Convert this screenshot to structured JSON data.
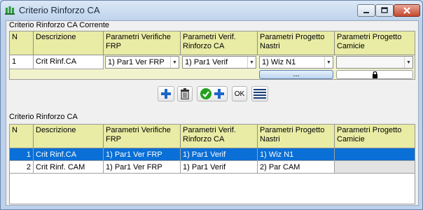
{
  "window": {
    "title": "Criterio Rinforzo CA"
  },
  "current": {
    "section_label": "Criterio Rinforzo CA Corrente",
    "headers": {
      "n": "N",
      "descrizione": "Descrizione",
      "frp": "Parametri Verifiche FRP",
      "ca": "Parametri Verif. Rinforzo CA",
      "nastri": "Parametri Progetto Nastri",
      "camicie": "Parametri Progetto Camicie"
    },
    "row": {
      "n": "1",
      "descrizione": "Crit Rinf.CA",
      "frp": "1) Par1 Ver FRP",
      "ca": "1) Par1 Verif",
      "nastri": "1) Wiz N1",
      "camicie": ""
    },
    "ellipsis_label": "..."
  },
  "toolbar": {
    "ok_label": "OK"
  },
  "list": {
    "section_label": "Criterio Rinforzo CA",
    "headers": {
      "n": "N",
      "descrizione": "Descrizione",
      "frp": "Parametri Verifiche FRP",
      "ca": "Parametri Verif. Rinforzo CA",
      "nastri": "Parametri Progetto Nastri",
      "camicie": "Parametri Progetto Camicie"
    },
    "rows": [
      {
        "n": "1",
        "descrizione": "Crit Rinf.CA",
        "frp": "1) Par1 Ver FRP",
        "ca": "1) Par1 Verif",
        "nastri": "1) Wiz N1",
        "camicie": ""
      },
      {
        "n": "2",
        "descrizione": "Crit Rinf. CAM",
        "frp": "1) Par1 Ver FRP",
        "ca": "1) Par1 Verif",
        "nastri": "2) Par CAM",
        "camicie": ""
      }
    ]
  },
  "colors": {
    "header_bg": "#e8eca4",
    "selection": "#0a6fd6",
    "accent_blue": "#1b66c9",
    "accent_green": "#23a01c"
  }
}
